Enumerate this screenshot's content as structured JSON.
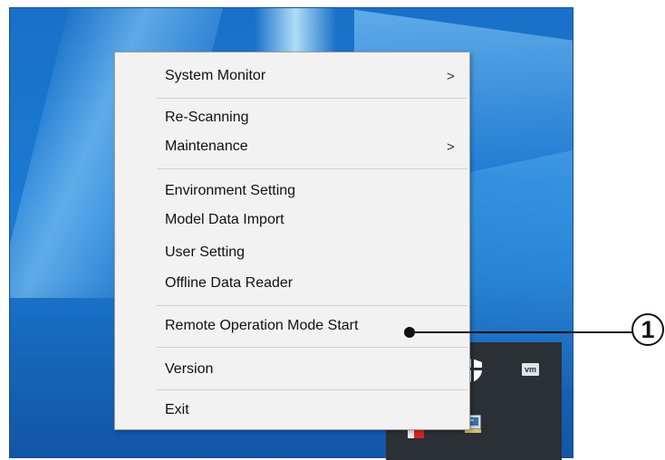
{
  "context_menu": {
    "items": [
      {
        "label": "System Monitor",
        "submenu_arrow": ">"
      },
      {
        "label": "Re-Scanning"
      },
      {
        "label": "Maintenance",
        "submenu_arrow": ">"
      },
      {
        "label": "Environment Setting"
      },
      {
        "label": "Model Data Import"
      },
      {
        "label": "User Setting"
      },
      {
        "label": "Offline Data Reader"
      },
      {
        "label": "Remote Operation Mode Start"
      },
      {
        "label": "Version"
      },
      {
        "label": "Exit"
      }
    ]
  },
  "taskbar_tray": {
    "icons": [
      "shield-icon",
      "vm-icon",
      "monitor-icon",
      "red-app-icon"
    ],
    "vm_icon_text": "vm",
    "background": "#2b3036"
  },
  "callout": {
    "number": "1",
    "target": "Remote Operation Mode Start"
  },
  "colors": {
    "desktop_blue": "#1b7ad2",
    "menu_background": "#f2f2f2",
    "menu_border": "#a0a0a0"
  }
}
